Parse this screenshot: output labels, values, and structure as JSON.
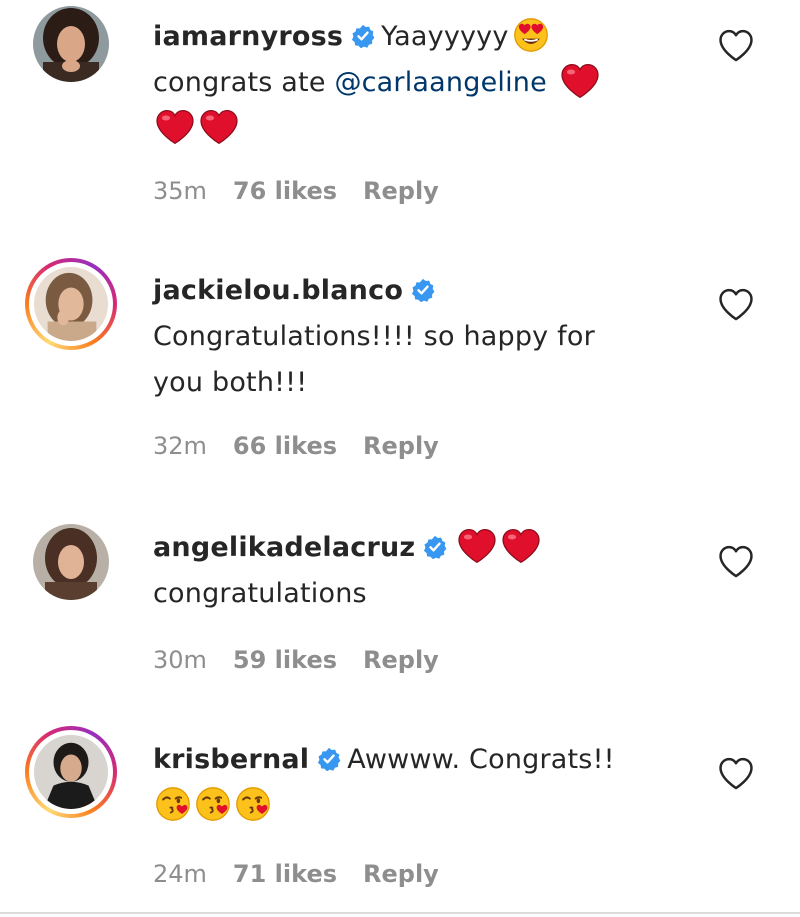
{
  "comments": [
    {
      "username": "iamarnyross",
      "text_1": "Yaayyyyy",
      "text_2": "congrats ate",
      "mention": "@carlaangeline",
      "time": "35m",
      "likes": "76 likes",
      "reply": "Reply"
    },
    {
      "username": "jackielou.blanco",
      "text_1": "Congratulations!!!! so happy for",
      "text_2": "you both!!!",
      "time": "32m",
      "likes": "66 likes",
      "reply": "Reply"
    },
    {
      "username": "angelikadelacruz",
      "text_1": "congratulations",
      "time": "30m",
      "likes": "59 likes",
      "reply": "Reply"
    },
    {
      "username": "krisbernal",
      "text_1": "Awwww. Congrats!!",
      "time": "24m",
      "likes": "71 likes",
      "reply": "Reply"
    }
  ],
  "colors": {
    "verified_blue": "#3897f0",
    "mention_blue": "#00376b",
    "heart_red": "#e0102c",
    "meta_gray": "#8e8e8e"
  },
  "icons": [
    "verified-badge-icon",
    "heart-outline-icon",
    "red-heart-emoji",
    "heart-eyes-emoji",
    "kissing-heart-emoji"
  ]
}
